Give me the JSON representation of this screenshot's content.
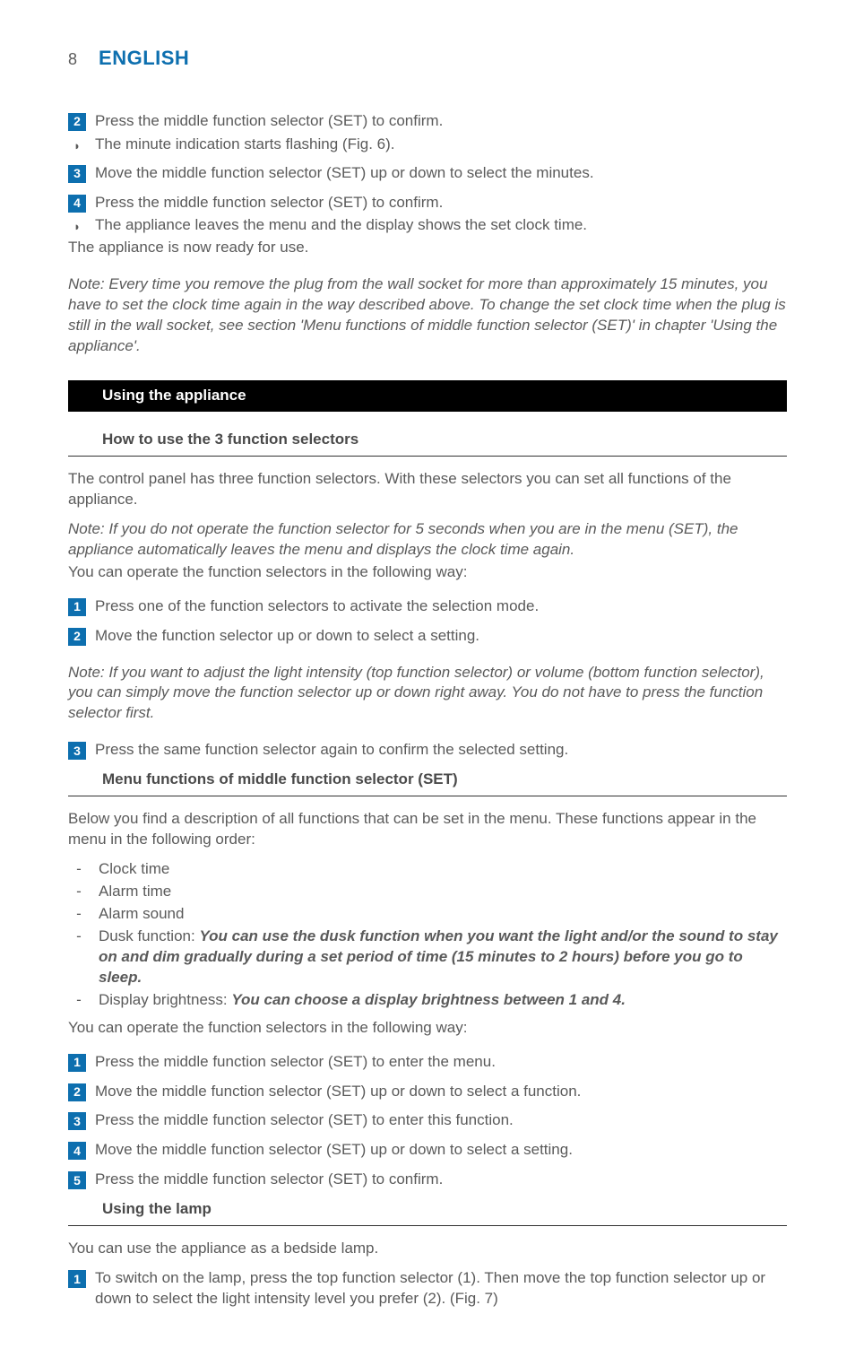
{
  "header": {
    "page_num": "8",
    "language": "ENGLISH"
  },
  "opening_steps": {
    "s2": "Press the middle function selector (SET) to confirm.",
    "s2_result": "The minute indication starts flashing (Fig. 6).",
    "s3": "Move the middle function selector (SET) up or down to select the minutes.",
    "s4": "Press the middle function selector (SET) to confirm.",
    "s4_result": "The appliance leaves the menu and the display shows the set clock time.",
    "ready": "The appliance is now ready for use."
  },
  "opening_note": "Note: Every time you remove the plug from the wall socket for more than approximately 15 minutes, you have to set the clock time again in the way described above. To change the set clock time when the plug is still in the wall socket, see section 'Menu functions of middle function selector (SET)' in chapter 'Using the appliance'.",
  "section_using": {
    "title": "Using the appliance",
    "sub_howto": {
      "heading": "How to use the 3 function selectors",
      "intro": "The control panel has three function selectors. With these selectors you can set all functions of the appliance.",
      "menu_note": "Note: If you do not operate the function selector for 5 seconds when you are in the menu (SET), the appliance automatically leaves the menu and displays the clock time again.",
      "operate_lead": "You can operate the function selectors in the following way:",
      "s1": "Press one of the function selectors to activate the selection mode.",
      "s2": "Move the function selector up or down to select a setting.",
      "light_note": "Note: If you want to adjust the light intensity (top function selector) or volume (bottom function selector), you can simply move the function selector up or down right away. You do not have to press the function selector first.",
      "s3": "Press the same function selector again to confirm the selected setting."
    },
    "sub_menu": {
      "heading": "Menu functions of middle function selector (SET)",
      "intro": "Below you find a description of all functions that can be set in the menu. These functions appear in the menu in the following order:",
      "items": {
        "clock": "Clock time",
        "alarm_time": "Alarm time",
        "alarm_sound": "Alarm sound",
        "dusk_label": "Dusk function: ",
        "dusk_desc": "You can use the dusk function when you want the light and/or the sound to stay on and dim gradually during a set period of time (15 minutes to 2 hours) before you go to sleep.",
        "disp_label": "Display brightness: ",
        "disp_desc": "You can choose a display brightness between 1 and 4."
      },
      "operate_lead": "You can operate the function selectors in the following way:",
      "s1": "Press the middle function selector (SET) to enter the menu.",
      "s2": "Move the middle function selector (SET) up or down to select a function.",
      "s3": "Press the middle function selector (SET) to enter this function.",
      "s4": "Move the middle function selector (SET) up or down to select a setting.",
      "s5": "Press the middle function selector (SET) to confirm."
    },
    "sub_lamp": {
      "heading": "Using the lamp",
      "intro": "You can use the appliance as a bedside lamp.",
      "s1": "To switch on the lamp, press the top function selector (1). Then move the top function selector up or down to select the light intensity level you prefer (2).  (Fig. 7)"
    }
  }
}
